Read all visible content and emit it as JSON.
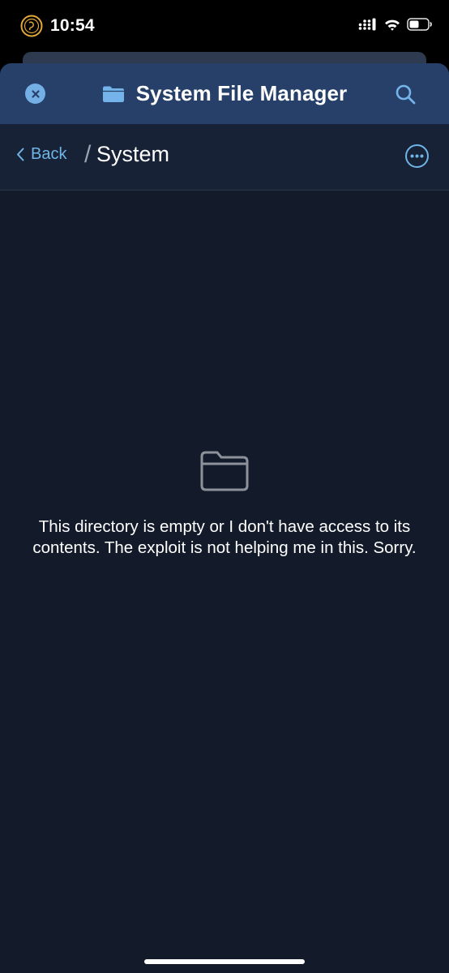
{
  "status_bar": {
    "time": "10:54",
    "app_icon": "app-badge-icon",
    "signal_icon": "cellular-signal-icon",
    "wifi_icon": "wifi-icon",
    "battery_icon": "battery-icon"
  },
  "header": {
    "title": "System File Manager",
    "close_icon": "close-icon",
    "folder_icon": "folder-icon",
    "search_icon": "search-icon"
  },
  "nav": {
    "back_label": "Back",
    "separator": "/",
    "current_path": "System",
    "more_icon": "more-options-icon"
  },
  "empty_state": {
    "icon": "folder-outline-icon",
    "message": "This directory is empty or I don't have access to its contents. The exploit is not helping me in this. Sorry."
  },
  "colors": {
    "header_bg": "#26406a",
    "nav_bg": "#172236",
    "content_bg": "#131b2a",
    "accent": "#6fb5e8"
  }
}
